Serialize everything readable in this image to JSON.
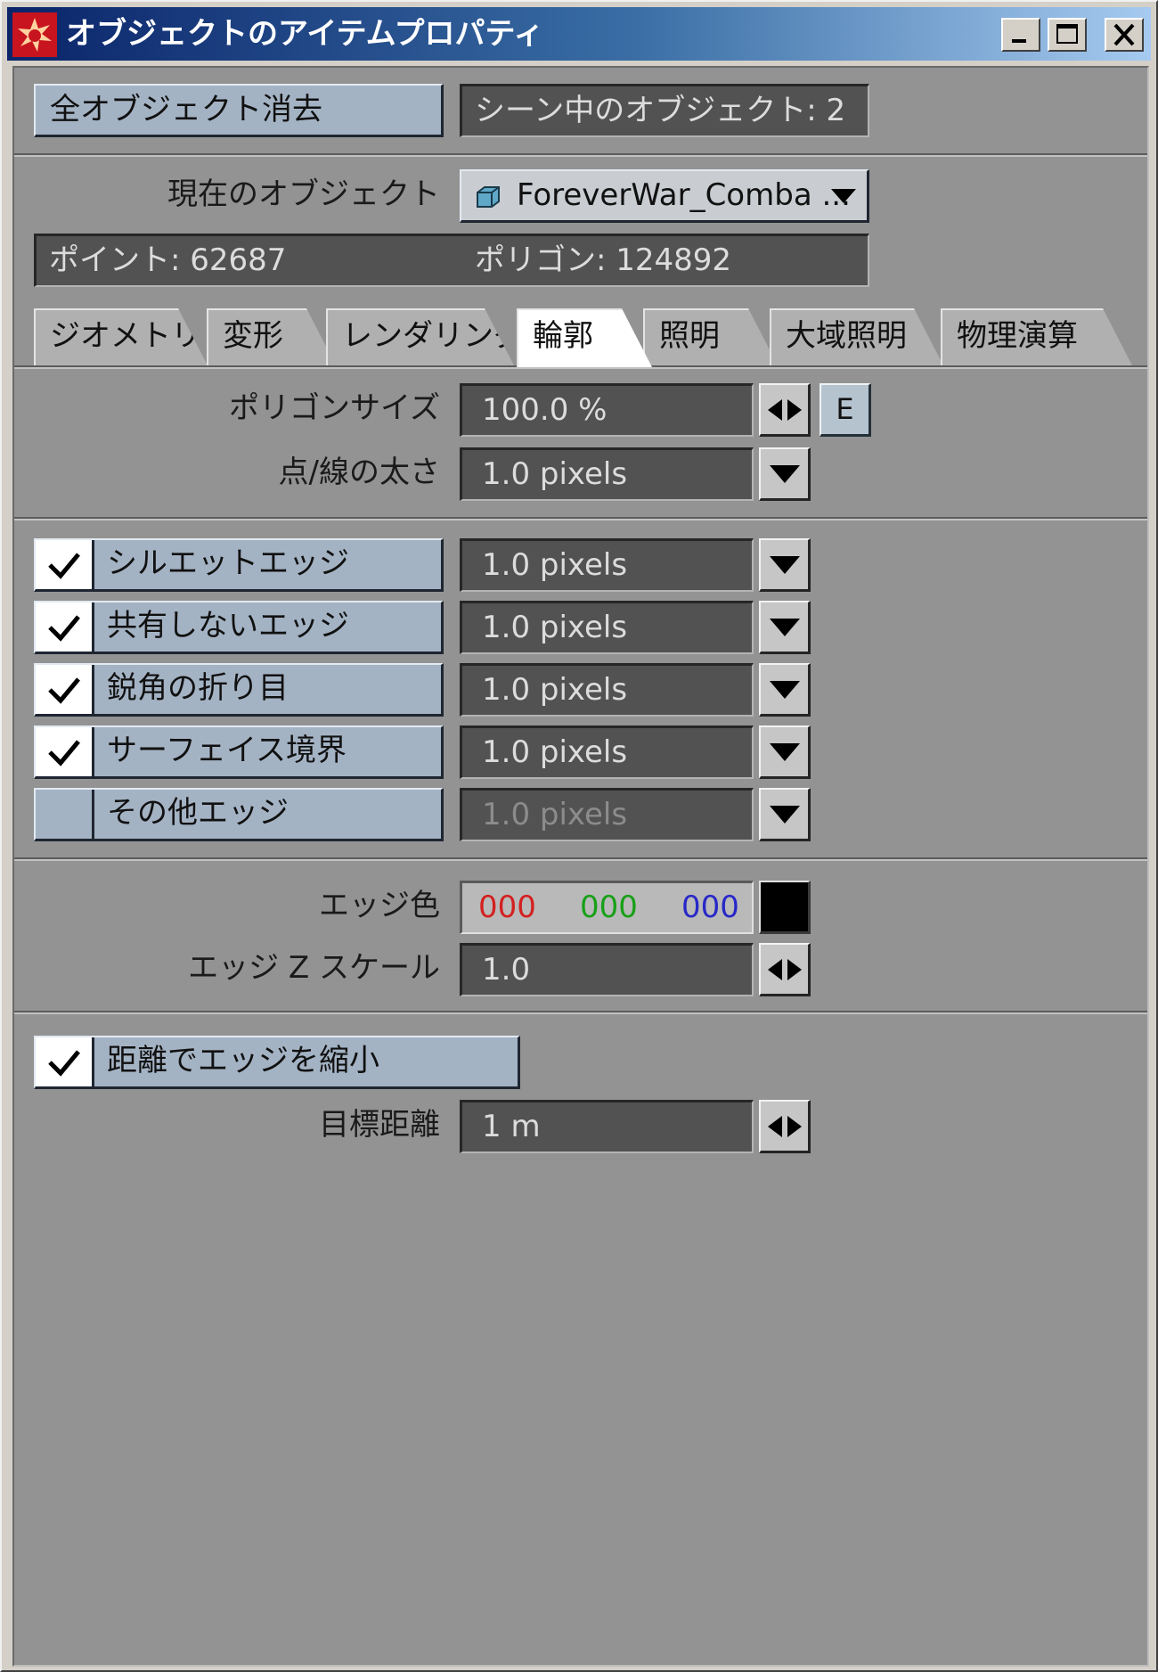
{
  "window": {
    "title": "オブジェクトのアイテムプロパティ"
  },
  "top": {
    "clear_all_label": "全オブジェクト消去",
    "scene_objects_text": "シーン中のオブジェクト: 2"
  },
  "object": {
    "label": "現在のオブジェクト",
    "selected": "ForeverWar_Comba ...",
    "points_text": "ポイント: 62687",
    "polygons_text": "ポリゴン: 124892"
  },
  "tabs": [
    {
      "label": "ジオメトリ",
      "active": false
    },
    {
      "label": "変形",
      "active": false
    },
    {
      "label": "レンダリング",
      "active": false
    },
    {
      "label": "輪郭",
      "active": true
    },
    {
      "label": "照明",
      "active": false
    },
    {
      "label": "大域照明",
      "active": false
    },
    {
      "label": "物理演算",
      "active": false
    }
  ],
  "geometry": {
    "polygon_size_label": "ポリゴンサイズ",
    "polygon_size_value": "100.0 %",
    "e_button": "E",
    "point_line_label": "点/線の太さ",
    "point_line_value": "1.0 pixels"
  },
  "edges": [
    {
      "label": "シルエットエッジ",
      "checked": true,
      "value": "1.0 pixels"
    },
    {
      "label": "共有しないエッジ",
      "checked": true,
      "value": "1.0 pixels"
    },
    {
      "label": "鋭角の折り目",
      "checked": true,
      "value": "1.0 pixels"
    },
    {
      "label": "サーフェイス境界",
      "checked": true,
      "value": "1.0 pixels"
    },
    {
      "label": "その他エッジ",
      "checked": false,
      "value": "1.0 pixels"
    }
  ],
  "edge_color": {
    "label": "エッジ色",
    "r": "000",
    "g": "000",
    "b": "000",
    "r_color": "#d42020",
    "g_color": "#18a018",
    "b_color": "#2828c8",
    "swatch_color": "#000000"
  },
  "edge_z": {
    "label": "エッジ Z スケール",
    "value": "1.0"
  },
  "distance": {
    "shrink_label": "距離でエッジを縮小",
    "shrink_checked": true,
    "target_label": "目標距離",
    "target_value": "1 m"
  }
}
